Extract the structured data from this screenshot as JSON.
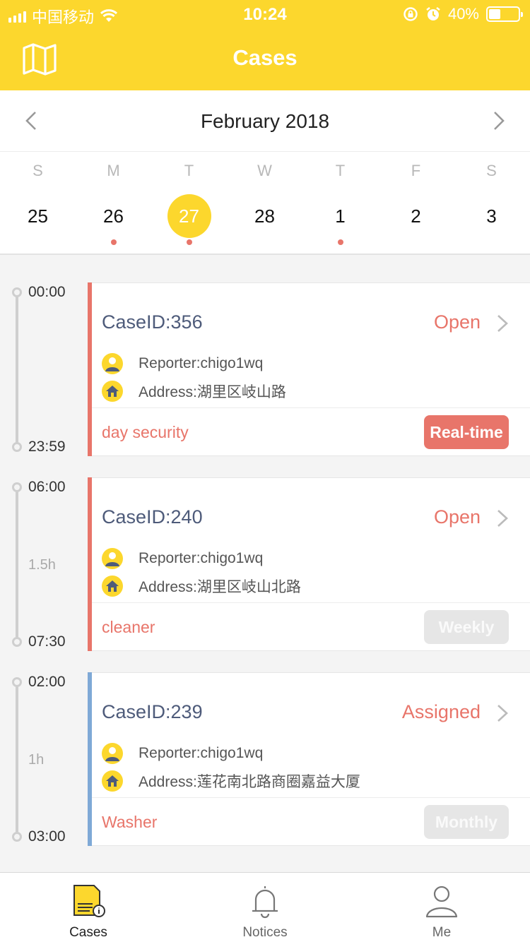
{
  "status_bar": {
    "carrier": "中国移动",
    "time": "10:24",
    "battery_percent": "40%",
    "battery_level": 0.4
  },
  "header": {
    "title": "Cases",
    "left_icon": "map-icon",
    "color": "#fcd72d"
  },
  "calendar": {
    "month_label": "February 2018",
    "prev_icon": "chevron-left-icon",
    "next_icon": "chevron-right-icon",
    "days": [
      {
        "dow": "S",
        "date": "25",
        "selected": false,
        "has_event": false
      },
      {
        "dow": "M",
        "date": "26",
        "selected": false,
        "has_event": true
      },
      {
        "dow": "T",
        "date": "27",
        "selected": true,
        "has_event": true
      },
      {
        "dow": "W",
        "date": "28",
        "selected": false,
        "has_event": false
      },
      {
        "dow": "T",
        "date": "1",
        "selected": false,
        "has_event": true
      },
      {
        "dow": "F",
        "date": "2",
        "selected": false,
        "has_event": false
      },
      {
        "dow": "S",
        "date": "3",
        "selected": false,
        "has_event": false
      }
    ]
  },
  "cases": [
    {
      "start": "00:00",
      "end": "23:59",
      "duration": "",
      "case_id": "CaseID:356",
      "status": "Open",
      "reporter": "Reporter:chigo1wq",
      "address": "Address:湖里区岐山路",
      "role": "day security",
      "tag": "Real-time",
      "tag_active": true,
      "accent": "#e8756a"
    },
    {
      "start": "06:00",
      "end": "07:30",
      "duration": "1.5h",
      "case_id": "CaseID:240",
      "status": "Open",
      "reporter": "Reporter:chigo1wq",
      "address": "Address:湖里区岐山北路",
      "role": "cleaner",
      "tag": "Weekly",
      "tag_active": false,
      "accent": "#e8756a"
    },
    {
      "start": "02:00",
      "end": "03:00",
      "duration": "1h",
      "case_id": "CaseID:239",
      "status": "Assigned",
      "reporter": "Reporter:chigo1wq",
      "address": "Address:莲花南北路商圈嘉益大厦",
      "role": "Washer",
      "tag": "Monthly",
      "tag_active": false,
      "accent": "#7fa9d6"
    }
  ],
  "tabbar": {
    "tabs": [
      {
        "label": "Cases",
        "icon": "document-icon",
        "active": true
      },
      {
        "label": "Notices",
        "icon": "bell-icon",
        "active": false
      },
      {
        "label": "Me",
        "icon": "user-icon",
        "active": false
      }
    ]
  }
}
